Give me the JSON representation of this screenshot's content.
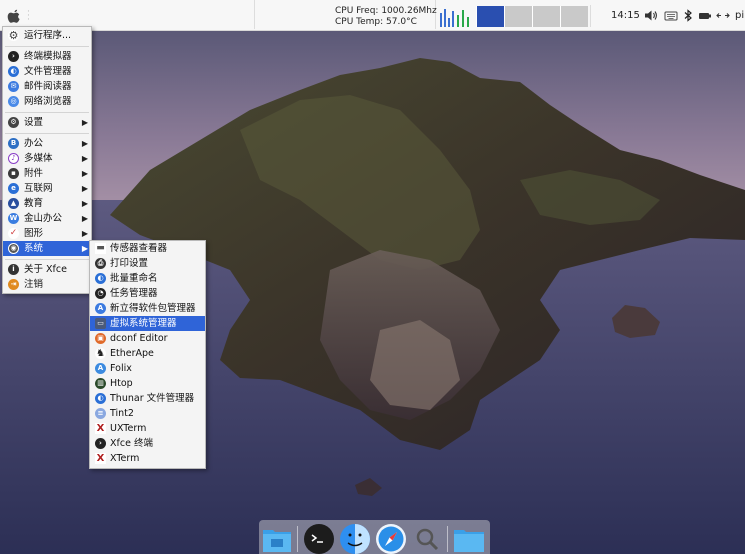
{
  "panel": {
    "cpu_freq": "CPU Freq: 1000.26Mhz",
    "cpu_temp": "CPU Temp: 57.0°C",
    "clock": "14:15",
    "user": "pi",
    "workspace_active": 1,
    "workspace_count": 4,
    "tray_icons": [
      "volume-icon",
      "keyboard-icon",
      "bluetooth-icon",
      "battery-icon",
      "network-icon"
    ]
  },
  "main_menu": {
    "items": [
      {
        "label": "运行程序...",
        "icon": "gear-icon",
        "color": "#555555"
      },
      {
        "label": "终端模拟器",
        "icon": "terminal-icon",
        "color": "#222222"
      },
      {
        "label": "文件管理器",
        "icon": "file-manager-icon",
        "color": "#2a6fd6"
      },
      {
        "label": "邮件阅读器",
        "icon": "mail-icon",
        "color": "#3c7be0"
      },
      {
        "label": "网络浏览器",
        "icon": "browser-icon",
        "color": "#4a8ae8"
      },
      {
        "label": "设置",
        "icon": "settings-icon",
        "color": "#444444"
      },
      {
        "label": "办公",
        "icon": "office-icon",
        "color": "#2d6fc4"
      },
      {
        "label": "多媒体",
        "icon": "multimedia-icon",
        "color": "#8a3fc7"
      },
      {
        "label": "附件",
        "icon": "accessories-icon",
        "color": "#3a3a3a"
      },
      {
        "label": "互联网",
        "icon": "internet-icon",
        "color": "#2a6fd6"
      },
      {
        "label": "教育",
        "icon": "education-icon",
        "color": "#2a4f9e"
      },
      {
        "label": "金山办公",
        "icon": "wps-icon",
        "color": "#3b7de0"
      },
      {
        "label": "图形",
        "icon": "graphics-icon",
        "color": "#d04040"
      },
      {
        "label": "系统",
        "icon": "system-icon",
        "color": "#555555"
      },
      {
        "label": "关于 Xfce",
        "icon": "info-icon",
        "color": "#333333"
      },
      {
        "label": "注销",
        "icon": "logout-icon",
        "color": "#e08a1e"
      }
    ]
  },
  "system_submenu": {
    "items": [
      {
        "label": "传感器查看器",
        "icon": "sensor-icon",
        "color": "#555555"
      },
      {
        "label": "打印设置",
        "icon": "printer-icon",
        "color": "#333333"
      },
      {
        "label": "批量重命名",
        "icon": "rename-icon",
        "color": "#2a6fd6"
      },
      {
        "label": "任务管理器",
        "icon": "task-manager-icon",
        "color": "#222222"
      },
      {
        "label": "新立得软件包管理器",
        "icon": "synaptic-icon",
        "color": "#3c7be0"
      },
      {
        "label": "虚拟系统管理器",
        "icon": "virt-manager-icon",
        "color": "#4a5a7a"
      },
      {
        "label": "dconf Editor",
        "icon": "dconf-icon",
        "color": "#e06a2a"
      },
      {
        "label": "EtherApe",
        "icon": "etherape-icon",
        "color": "#222222"
      },
      {
        "label": "Folix",
        "icon": "folix-icon",
        "color": "#3c8be0"
      },
      {
        "label": "Htop",
        "icon": "htop-icon",
        "color": "#2a4a2a"
      },
      {
        "label": "Thunar 文件管理器",
        "icon": "thunar-icon",
        "color": "#2a6fd6"
      },
      {
        "label": "Tint2",
        "icon": "tint2-icon",
        "color": "#8aa8e0"
      },
      {
        "label": "UXTerm",
        "icon": "uxterm-icon",
        "color": "#b02020"
      },
      {
        "label": "Xfce 终端",
        "icon": "xfce-terminal-icon",
        "color": "#222222"
      },
      {
        "label": "XTerm",
        "icon": "xterm-icon",
        "color": "#b02020"
      }
    ],
    "selected_index": 5
  },
  "dock": {
    "items": [
      "desktop-folder-icon",
      "terminal-icon",
      "finder-icon",
      "safari-icon",
      "search-icon",
      "folder-icon"
    ]
  }
}
